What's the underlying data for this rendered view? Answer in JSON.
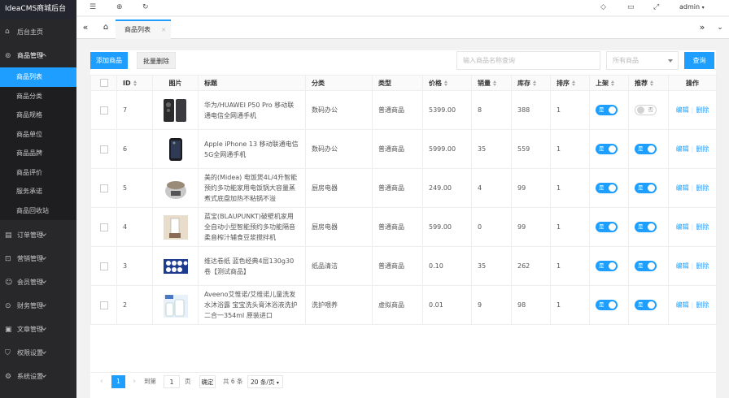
{
  "app": {
    "title": "IdeaCMS商城后台"
  },
  "sidebar": {
    "home": {
      "label": "后台主页",
      "icon": "home-icon"
    },
    "goods": {
      "label": "商品管理",
      "icon": "product-icon",
      "items": [
        "商品列表",
        "商品分类",
        "商品规格",
        "商品单位",
        "商品品牌",
        "商品评价",
        "服务承诺",
        "商品回收站"
      ]
    },
    "groups": [
      {
        "label": "订单管理",
        "icon": "order-icon"
      },
      {
        "label": "营销管理",
        "icon": "marketing-icon"
      },
      {
        "label": "会员管理",
        "icon": "user-icon"
      },
      {
        "label": "财务管理",
        "icon": "finance-icon"
      },
      {
        "label": "文章管理",
        "icon": "article-icon"
      },
      {
        "label": "权限设置",
        "icon": "permission-icon"
      },
      {
        "label": "系统设置",
        "icon": "settings-icon"
      }
    ]
  },
  "header": {
    "user": "admin"
  },
  "tabs": [
    {
      "label": "商品列表"
    }
  ],
  "toolbar": {
    "add_label": "添加商品",
    "batch_delete_label": "批量删除",
    "search_placeholder": "输入商品名称查询",
    "filter_value": "所有商品",
    "search_label": "查询"
  },
  "table": {
    "headers": {
      "id": "ID",
      "image": "图片",
      "title": "标题",
      "category": "分类",
      "type": "类型",
      "price": "价格",
      "sales": "销量",
      "stock": "库存",
      "sort": "排序",
      "on_shelf": "上架",
      "recommend": "推荐",
      "actions": "操作"
    },
    "switch_on": "是",
    "switch_off": "否",
    "edit_label": "编辑",
    "delete_label": "删除",
    "rows": [
      {
        "id": "7",
        "title": "华为/HUAWEI P50 Pro 移动联通电信全网通手机",
        "category": "数码办公",
        "type": "普通商品",
        "price": "5399.00",
        "sales": "8",
        "stock": "388",
        "sort": "1",
        "on_shelf": true,
        "recommend": false,
        "image": "phone-dark"
      },
      {
        "id": "6",
        "title": "Apple iPhone 13 移动联通电信5G全网通手机",
        "category": "数码办公",
        "type": "普通商品",
        "price": "5999.00",
        "sales": "35",
        "stock": "559",
        "sort": "1",
        "on_shelf": true,
        "recommend": true,
        "image": "phone-black"
      },
      {
        "id": "5",
        "title": "美的(Midea) 电饭煲4L/4升智能预约多功能家用电饭锅大容量蒸煮式底盘加热不粘锅不溢",
        "category": "厨房电器",
        "type": "普通商品",
        "price": "249.00",
        "sales": "4",
        "stock": "99",
        "sort": "1",
        "on_shelf": true,
        "recommend": true,
        "image": "rice-cooker"
      },
      {
        "id": "4",
        "title": "蓝宝(BLAUPUNKT)破壁机家用全自动小型智能预约多功能隔音柔音榨汁辅食豆浆搅拌机",
        "category": "厨房电器",
        "type": "普通商品",
        "price": "599.00",
        "sales": "0",
        "stock": "99",
        "sort": "1",
        "on_shelf": true,
        "recommend": true,
        "image": "blender"
      },
      {
        "id": "3",
        "title": "维达卷纸 蓝色经典4层130g30卷【测试商品】",
        "category": "纸品清洁",
        "type": "普通商品",
        "price": "0.10",
        "sales": "35",
        "stock": "262",
        "sort": "1",
        "on_shelf": true,
        "recommend": true,
        "image": "tissue"
      },
      {
        "id": "2",
        "title": "Aveeno艾惟诺/艾维诺儿童洗发水沐浴露 宝宝洗头膏沐浴液洗护二合一354ml 原装进口",
        "category": "洗护喂养",
        "type": "虚拟商品",
        "price": "0.01",
        "sales": "9",
        "stock": "98",
        "sort": "1",
        "on_shelf": true,
        "recommend": true,
        "image": "lotion"
      }
    ]
  },
  "pager": {
    "prev": "‹",
    "current": "1",
    "next": "›",
    "goto_label": "到第",
    "goto_value": "1",
    "page_unit": "页",
    "confirm": "确定",
    "total": "共 6 条",
    "page_size": "20 条/页"
  },
  "colors": {
    "accent": "#1e9fff",
    "sidebar": "#28282a"
  }
}
